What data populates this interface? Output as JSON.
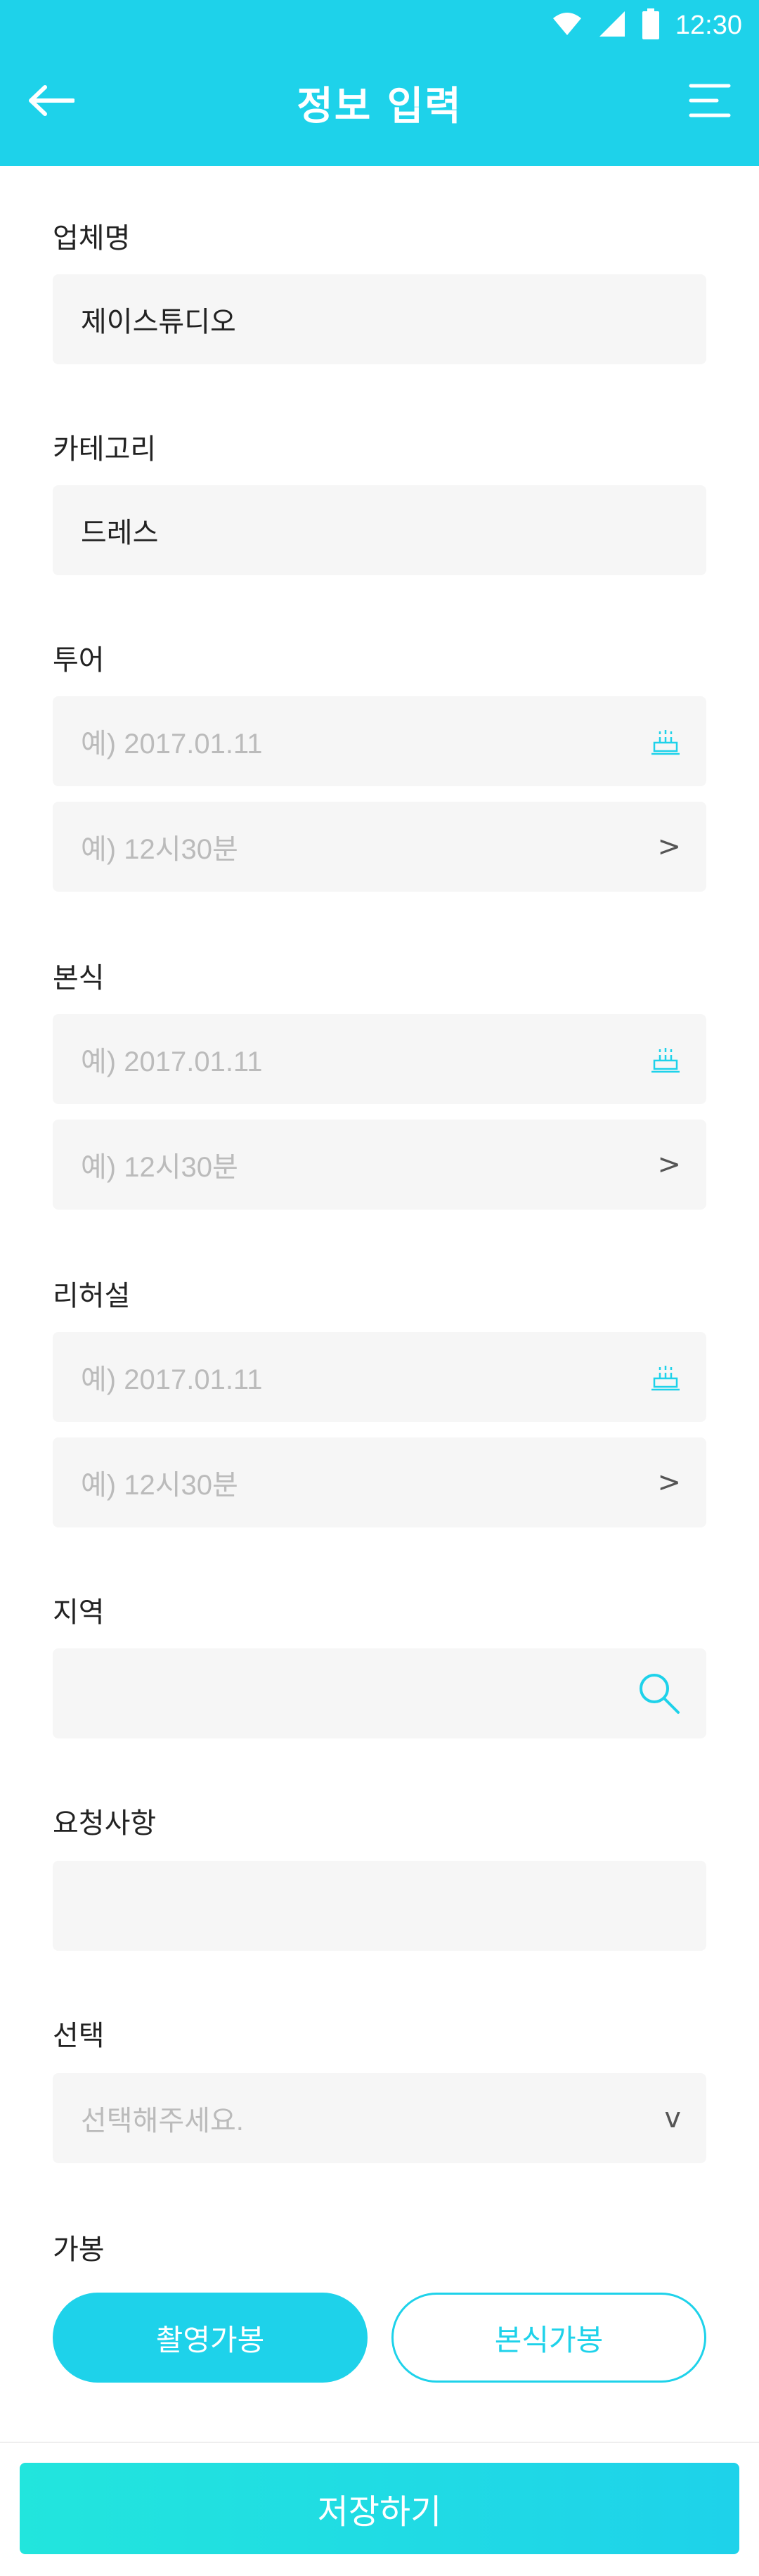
{
  "status_bar": {
    "time": "12:30"
  },
  "app_bar": {
    "title": "정보 입력"
  },
  "company": {
    "label": "업체명",
    "value": "제이스튜디오"
  },
  "category": {
    "label": "카테고리",
    "value": "드레스"
  },
  "tour": {
    "label": "투어",
    "date_placeholder": "예) 2017.01.11",
    "time_placeholder": "예) 12시30분"
  },
  "ceremony": {
    "label": "본식",
    "date_placeholder": "예) 2017.01.11",
    "time_placeholder": "예) 12시30분"
  },
  "rehearsal": {
    "label": "리허설",
    "date_placeholder": "예) 2017.01.11",
    "time_placeholder": "예) 12시30분"
  },
  "region": {
    "label": "지역",
    "value": ""
  },
  "requests": {
    "label": "요청사항",
    "value": ""
  },
  "selection": {
    "label": "선택",
    "placeholder": "선택해주세요."
  },
  "availability": {
    "label": "가봉",
    "options": [
      "촬영가봉",
      "본식가봉"
    ],
    "selected": "촬영가봉"
  },
  "save": {
    "label": "저장하기"
  },
  "icons": {
    "chevron_right": ">",
    "chevron_down": "v"
  },
  "colors": {
    "accent": "#1ed2ea",
    "field_bg": "#f6f6f6",
    "placeholder": "#bbbbbb"
  }
}
